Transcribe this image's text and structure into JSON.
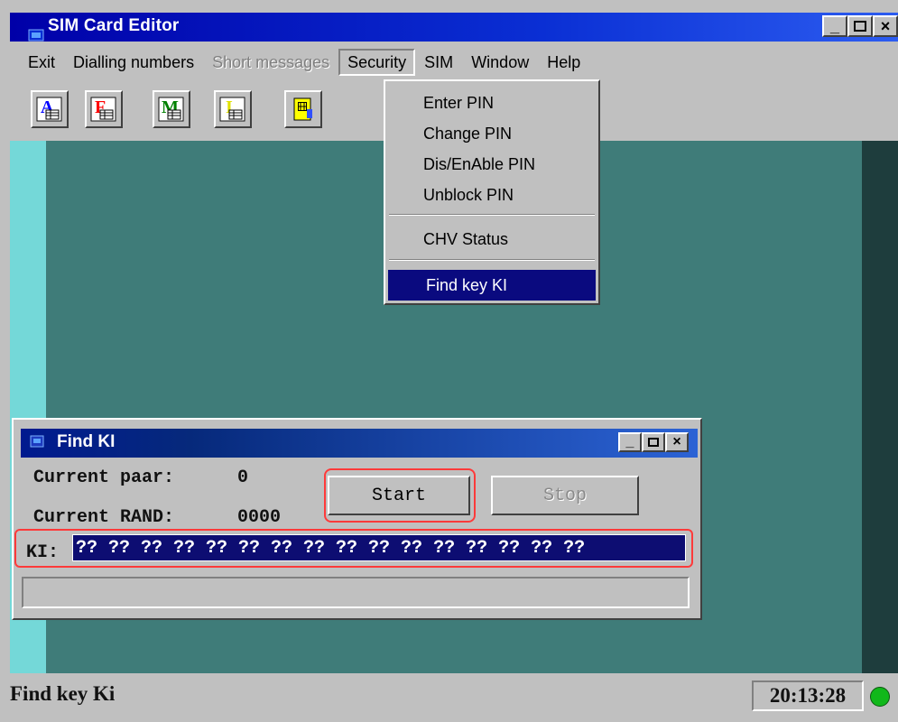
{
  "app": {
    "title": "SIM Card Editor"
  },
  "menu": {
    "items": [
      {
        "label": "Exit",
        "state": "normal"
      },
      {
        "label": "Dialling numbers",
        "state": "normal"
      },
      {
        "label": "Short messages",
        "state": "disabled"
      },
      {
        "label": "Security",
        "state": "active"
      },
      {
        "label": "SIM",
        "state": "normal"
      },
      {
        "label": "Window",
        "state": "normal"
      },
      {
        "label": "Help",
        "state": "normal"
      }
    ]
  },
  "toolbar": {
    "buttons": [
      {
        "icon": "a-table-icon",
        "letter": "A",
        "color": "#0000ff"
      },
      {
        "icon": "f-table-icon",
        "letter": "F",
        "color": "#ff0000"
      },
      {
        "icon": "m-table-icon",
        "letter": "M",
        "color": "#008000"
      },
      {
        "icon": "i-table-icon",
        "letter": "I",
        "color": "#ffff00"
      },
      {
        "icon": "sim-card-icon",
        "letter": "",
        "color": "#ffff00"
      }
    ]
  },
  "security_menu": {
    "items": [
      {
        "label": "Enter PIN"
      },
      {
        "label": "Change PIN"
      },
      {
        "label": "Dis/EnAble PIN"
      },
      {
        "label": "Unblock PIN"
      },
      {
        "label": "CHV Status"
      },
      {
        "label": "Find key KI",
        "selected": true
      }
    ]
  },
  "find_ki": {
    "title": "Find KI",
    "current_paar_label": "Current paar:",
    "current_paar_value": "0",
    "current_rand_label": "Current RAND:",
    "current_rand_value": "0000",
    "ki_label": "KI:",
    "ki_value": "?? ?? ?? ?? ?? ?? ?? ?? ?? ?? ?? ?? ?? ?? ?? ??",
    "start_label": "Start",
    "stop_label": "Stop"
  },
  "status_bar": {
    "message": "Find key Ki",
    "time": "20:13:28",
    "indicator_color": "#11b81b"
  }
}
